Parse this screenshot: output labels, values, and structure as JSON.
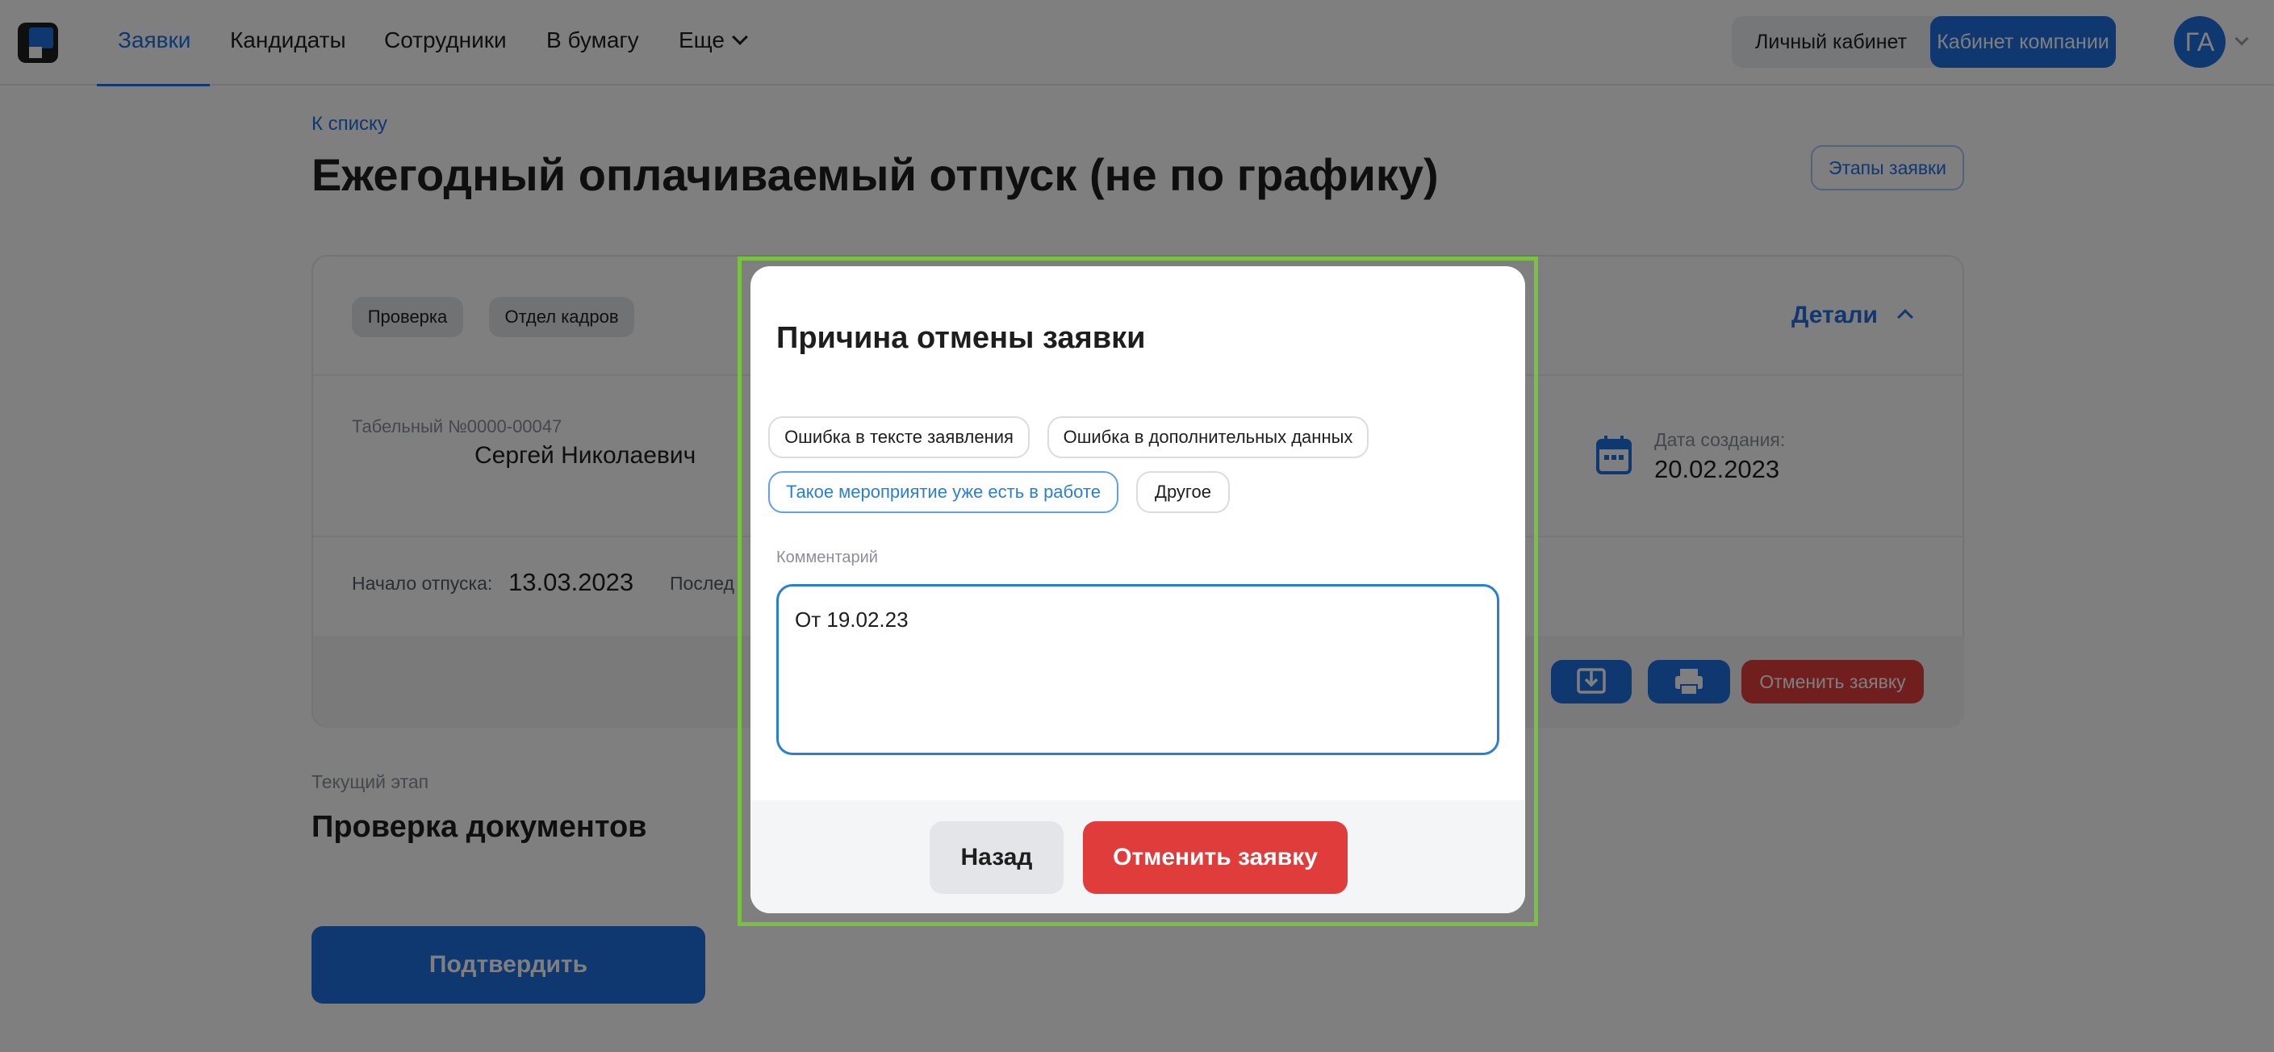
{
  "topbar": {
    "nav": [
      "Заявки",
      "Кандидаты",
      "Сотрудники",
      "В бумагу",
      "Еще"
    ],
    "cabinet_personal": "Личный кабинет",
    "cabinet_company": "Кабинет компании",
    "avatar_initials": "ГА"
  },
  "page": {
    "back_link": "К списку",
    "title": "Ежегодный оплачиваемый отпуск (не по графику)",
    "stages_button": "Этапы заявки"
  },
  "card": {
    "tags": [
      "Проверка",
      "Отдел кадров"
    ],
    "details": "Детали",
    "tab_number": "Табельный №0000-00047",
    "employee_name": "Сергей Николаевич",
    "created_label": "Дата создания:",
    "created_value": "20.02.2023",
    "start_label": "Начало отпуска:",
    "start_value": "13.03.2023",
    "last_label": "Послед",
    "cancel_button": "Отменить заявку"
  },
  "stage": {
    "label": "Текущий этап",
    "value": "Проверка документов",
    "confirm_button": "Подтвердить"
  },
  "modal": {
    "title": "Причина отмены заявки",
    "reasons": [
      "Ошибка в тексте заявления",
      "Ошибка в дополнительных данных",
      "Такое мероприятие уже есть в работе",
      "Другое"
    ],
    "selected_reason_index": 2,
    "comment_label": "Комментарий",
    "comment_value": "От 19.02.23",
    "back_button": "Назад",
    "cancel_button": "Отменить заявку"
  },
  "colors": {
    "accent": "#1f6fe0",
    "danger": "#e03c3c",
    "focus_frame": "#7ac143"
  }
}
